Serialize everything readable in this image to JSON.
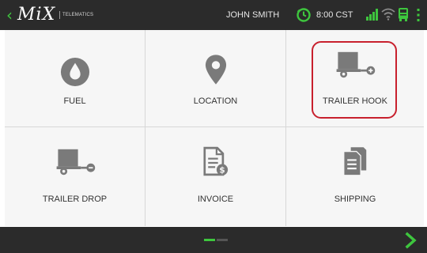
{
  "header": {
    "logo": "MiX",
    "logo_sub": "TELEMATICS",
    "user_name": "JOHN SMITH",
    "time": "8:00 CST",
    "icons": {
      "back": "chevron-left-icon",
      "clock": "clock-icon",
      "signal": "signal-icon",
      "wifi": "wifi-icon",
      "vehicle": "bus-icon",
      "menu": "kebab-menu-icon"
    }
  },
  "tiles": [
    {
      "label": "FUEL",
      "icon": "fuel-drop-icon"
    },
    {
      "label": "LOCATION",
      "icon": "location-pin-icon"
    },
    {
      "label": "TRAILER HOOK",
      "icon": "trailer-hook-icon",
      "highlighted": true
    },
    {
      "label": "TRAILER DROP",
      "icon": "trailer-drop-icon"
    },
    {
      "label": "INVOICE",
      "icon": "invoice-icon"
    },
    {
      "label": "SHIPPING",
      "icon": "shipping-documents-icon"
    }
  ],
  "footer": {
    "pages": 2,
    "current_page": 1,
    "next_icon": "chevron-right-icon"
  },
  "colors": {
    "bar_bg": "#2b2b2b",
    "accent_green": "#3ec63e",
    "icon_gray": "#7a7a7a",
    "highlight_red": "#c8202d",
    "tile_bg": "#f6f6f6"
  }
}
